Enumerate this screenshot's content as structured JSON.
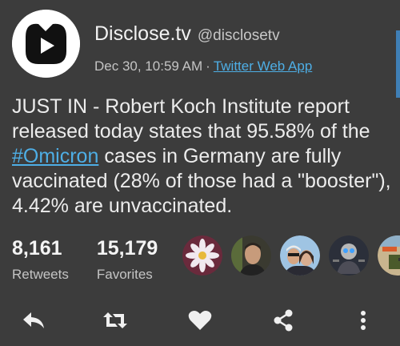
{
  "colors": {
    "background": "#3c3c3c",
    "link": "#4eaee5",
    "text": "#ececec",
    "muted": "#c4c4c4"
  },
  "tweet": {
    "author": {
      "display_name": "Disclose.tv",
      "handle": "@disclosetv",
      "avatar_icon": "disclose-tv-logo-icon"
    },
    "timestamp": "Dec 30, 10:59 AM",
    "separator": "·",
    "source": "Twitter Web App",
    "text_before": "JUST IN - Robert Koch Institute report released today states that 95.58% of the ",
    "hashtag": "#Omicron",
    "text_after": " cases in Germany are fully vaccinated (28% of those had a \"booster\"), 4.42% are unvaccinated."
  },
  "stats": {
    "retweets": {
      "count": "8,161",
      "label": "Retweets"
    },
    "favorites": {
      "count": "15,179",
      "label": "Favorites"
    }
  },
  "favoriters": [
    {
      "icon": "flower-avatar-icon"
    },
    {
      "icon": "man-portrait-avatar-icon"
    },
    {
      "icon": "couple-avatar-icon"
    },
    {
      "icon": "cartoon-avatar-icon"
    },
    {
      "icon": "game-art-avatar-icon"
    }
  ],
  "actions": [
    {
      "icon": "reply-icon"
    },
    {
      "icon": "retweet-icon"
    },
    {
      "icon": "heart-icon"
    },
    {
      "icon": "share-icon"
    },
    {
      "icon": "more-vertical-icon"
    }
  ]
}
